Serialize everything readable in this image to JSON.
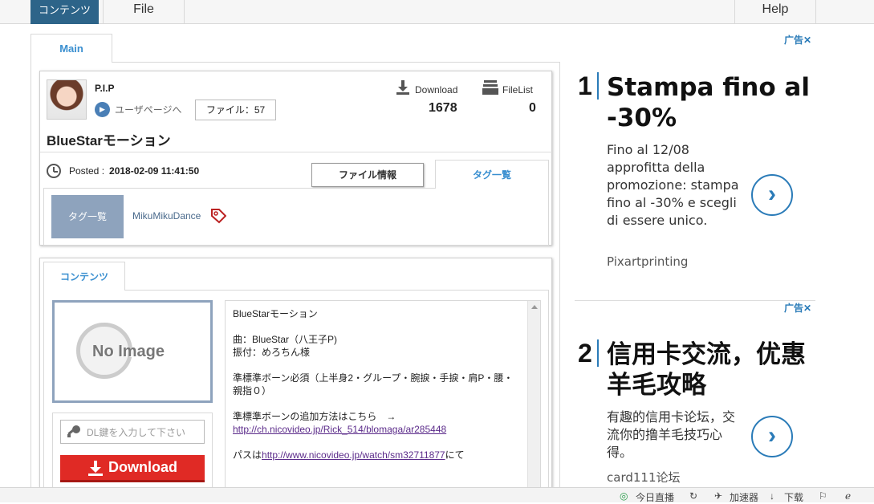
{
  "topbar": {
    "contents_tab": "コンテンツ",
    "file_tab": "File",
    "help_tab": "Help"
  },
  "main_tab": "Main",
  "user": {
    "name": "P.I.P",
    "userpage_link": "ユーザページへ",
    "file_count_label": "ファイル：57",
    "download_label": "Download",
    "download_count": "1678",
    "filelist_label": "FileList",
    "filelist_count": "0"
  },
  "file": {
    "title": "BlueStarモーション",
    "posted_label": "Posted :",
    "posted_date": "2018-02-09 11:41:50",
    "file_info_button": "ファイル情報",
    "tag_list_tab": "タグ一覧",
    "tag_box_label": "タグ一覧",
    "tags": [
      "MikuMikuDance"
    ]
  },
  "contents": {
    "tab": "コンテンツ",
    "no_image_text": "No Image",
    "dl_key_placeholder": "DL鍵を入力して下さい",
    "download_button": "Download",
    "description": {
      "line1": "BlueStarモーション",
      "line2": "曲：BlueStar（八王子P)",
      "line3": "振付：めろちん様",
      "line4": "準標準ボーン必須（上半身2・グループ・腕捩・手捩・肩P・腰・親指０）",
      "line5_prefix": "準標準ボーンの追加方法はこちら　→　",
      "line5_link": "http://ch.nicovideo.jp/Rick_514/blomaga/ar285448",
      "line6_prefix": "パスは",
      "line6_link": "http://www.nicovideo.jp/watch/sm32711877",
      "line6_suffix": "にて"
    }
  },
  "ads": [
    {
      "label": "广告✕",
      "number": "1",
      "headline": "Stampa fino al -30%",
      "body": "Fino al 12/08 approfitta della promozione: stampa fino al -30% e scegli di essere unico.",
      "brand": "Pixartprinting"
    },
    {
      "label": "广告✕",
      "number": "2",
      "headline": "信用卡交流，优惠羊毛攻略",
      "body": "有趣的信用卡论坛，交流你的撸羊毛技巧心得。",
      "brand": "card111论坛"
    }
  ],
  "statusbar": {
    "live": "今日直播",
    "accelerator": "加速器",
    "download": "下载"
  },
  "colors": {
    "accent": "#2d6489",
    "link": "#3a8fd0",
    "download_red": "#e02a25",
    "tag_box": "#8ea3bd"
  }
}
